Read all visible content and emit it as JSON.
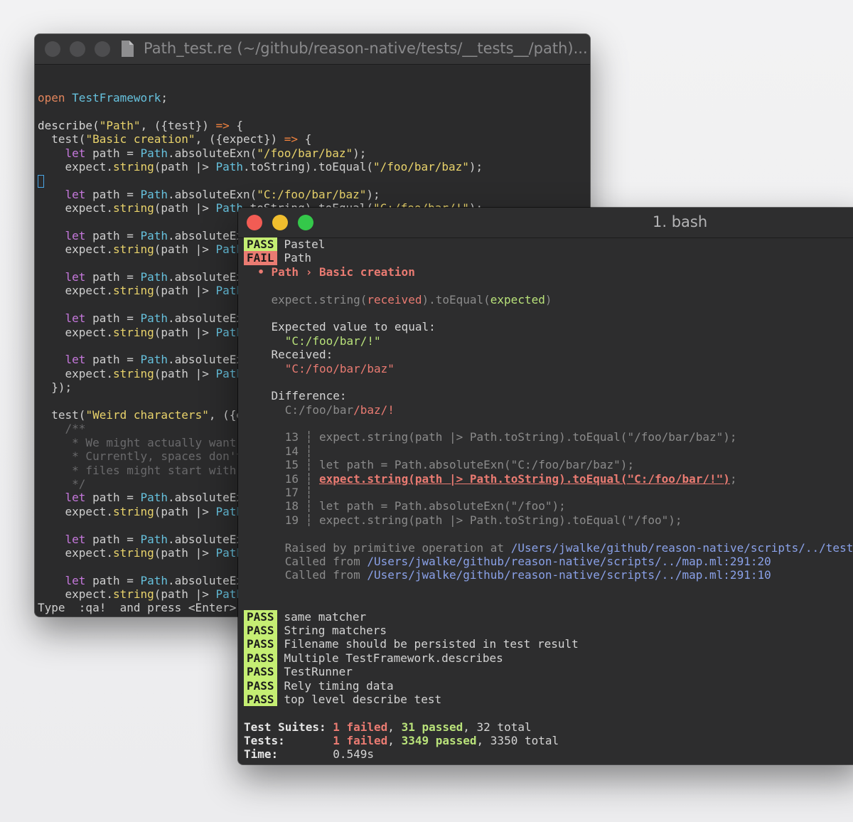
{
  "editor": {
    "title": "Path_test.re (~/github/reason-native/tests/__tests__/path)...",
    "status_line": "Type  :qa!  and press <Enter>...d",
    "code_lines": [
      [
        [
          "kw",
          "open"
        ],
        [
          "",
          " "
        ],
        [
          "mod",
          "TestFramework"
        ],
        [
          "",
          ";"
        ]
      ],
      [],
      [
        [
          "fn",
          "describe("
        ],
        [
          "str",
          "\"Path\""
        ],
        [
          "",
          ", ({test}) "
        ],
        [
          "op",
          "=>"
        ],
        [
          "",
          " {"
        ]
      ],
      [
        [
          "",
          "  test("
        ],
        [
          "str",
          "\"Basic creation\""
        ],
        [
          "",
          ", ({expect}) "
        ],
        [
          "op",
          "=>"
        ],
        [
          "",
          " {"
        ]
      ],
      [
        [
          "",
          "    "
        ],
        [
          "let",
          "let"
        ],
        [
          "",
          " path = "
        ],
        [
          "mod",
          "Path"
        ],
        [
          "",
          ".absoluteExn("
        ],
        [
          "str",
          "\"/foo/bar/baz\""
        ],
        [
          "",
          ");"
        ]
      ],
      [
        [
          "",
          "    expect."
        ],
        [
          "str",
          "string"
        ],
        [
          "",
          "(path |> "
        ],
        [
          "mod",
          "Path"
        ],
        [
          "",
          ".toString).toEqual("
        ],
        [
          "str",
          "\"/foo/bar/baz\""
        ],
        [
          "",
          ");"
        ]
      ],
      [
        [
          "cursor",
          ""
        ]
      ],
      [
        [
          "",
          "    "
        ],
        [
          "let",
          "let"
        ],
        [
          "",
          " path = "
        ],
        [
          "mod",
          "Path"
        ],
        [
          "",
          ".absoluteExn("
        ],
        [
          "str",
          "\"C:/foo/bar/baz\""
        ],
        [
          "",
          ");"
        ]
      ],
      [
        [
          "",
          "    expect."
        ],
        [
          "str",
          "string"
        ],
        [
          "",
          "(path |> "
        ],
        [
          "mod",
          "Path"
        ],
        [
          "",
          ".toString).toEqual("
        ],
        [
          "str",
          "\"C:/foo/bar/!\""
        ],
        [
          "",
          ");"
        ]
      ],
      [],
      [
        [
          "",
          "    "
        ],
        [
          "let",
          "let"
        ],
        [
          "",
          " path = "
        ],
        [
          "mod",
          "Path"
        ],
        [
          "",
          ".absoluteExn("
        ]
      ],
      [
        [
          "",
          "    expect."
        ],
        [
          "str",
          "string"
        ],
        [
          "",
          "(path |> "
        ],
        [
          "mod",
          "Path"
        ],
        [
          "",
          ".t"
        ]
      ],
      [],
      [
        [
          "",
          "    "
        ],
        [
          "let",
          "let"
        ],
        [
          "",
          " path = "
        ],
        [
          "mod",
          "Path"
        ],
        [
          "",
          ".absoluteExn("
        ]
      ],
      [
        [
          "",
          "    expect."
        ],
        [
          "str",
          "string"
        ],
        [
          "",
          "(path |> "
        ],
        [
          "mod",
          "Path"
        ],
        [
          "",
          ".t"
        ]
      ],
      [],
      [
        [
          "",
          "    "
        ],
        [
          "let",
          "let"
        ],
        [
          "",
          " path = "
        ],
        [
          "mod",
          "Path"
        ],
        [
          "",
          ".absoluteExn("
        ]
      ],
      [
        [
          "",
          "    expect."
        ],
        [
          "str",
          "string"
        ],
        [
          "",
          "(path |> "
        ],
        [
          "mod",
          "Path"
        ],
        [
          "",
          ".t"
        ]
      ],
      [],
      [
        [
          "",
          "    "
        ],
        [
          "let",
          "let"
        ],
        [
          "",
          " path = "
        ],
        [
          "mod",
          "Path"
        ],
        [
          "",
          ".absoluteExn("
        ]
      ],
      [
        [
          "",
          "    expect."
        ],
        [
          "str",
          "string"
        ],
        [
          "",
          "(path |> "
        ],
        [
          "mod",
          "Path"
        ],
        [
          "",
          ".t"
        ]
      ],
      [
        [
          "",
          "  });"
        ]
      ],
      [],
      [
        [
          "",
          "  test("
        ],
        [
          "str",
          "\"Weird characters\""
        ],
        [
          "",
          ", ({exp"
        ]
      ],
      [
        [
          "cm",
          "    /**"
        ]
      ],
      [
        [
          "cm",
          "     * We might actually want to"
        ]
      ],
      [
        [
          "cm",
          "     * Currently, spaces don't n"
        ]
      ],
      [
        [
          "cm",
          "     * files might start with a"
        ]
      ],
      [
        [
          "cm",
          "     */"
        ]
      ],
      [
        [
          "",
          "    "
        ],
        [
          "let",
          "let"
        ],
        [
          "",
          " path = "
        ],
        [
          "mod",
          "Path"
        ],
        [
          "",
          ".absoluteExn("
        ]
      ],
      [
        [
          "",
          "    expect."
        ],
        [
          "str",
          "string"
        ],
        [
          "",
          "(path |> "
        ],
        [
          "mod",
          "Path"
        ],
        [
          "",
          ".t"
        ]
      ],
      [],
      [
        [
          "",
          "    "
        ],
        [
          "let",
          "let"
        ],
        [
          "",
          " path = "
        ],
        [
          "mod",
          "Path"
        ],
        [
          "",
          ".absoluteExn("
        ]
      ],
      [
        [
          "",
          "    expect."
        ],
        [
          "str",
          "string"
        ],
        [
          "",
          "(path |> "
        ],
        [
          "mod",
          "Path"
        ],
        [
          "",
          ".t"
        ]
      ],
      [],
      [
        [
          "",
          "    "
        ],
        [
          "let",
          "let"
        ],
        [
          "",
          " path = "
        ],
        [
          "mod",
          "Path"
        ],
        [
          "",
          ".absoluteExn("
        ]
      ],
      [
        [
          "",
          "    expect."
        ],
        [
          "str",
          "string"
        ],
        [
          "",
          "(path |> "
        ],
        [
          "mod",
          "Path"
        ],
        [
          "",
          ".t"
        ]
      ]
    ]
  },
  "terminal": {
    "title": "1. bash",
    "lines": [
      [
        [
          "badge-pass",
          "PASS"
        ],
        [
          "",
          "Pastel"
        ]
      ],
      [
        [
          "badge-fail",
          "FAIL"
        ],
        [
          "",
          "Path"
        ]
      ],
      [
        [
          "red bold",
          "  • Path › Basic creation"
        ]
      ],
      [],
      [
        [
          "dim",
          "    expect.string("
        ],
        [
          "red",
          "received"
        ],
        [
          "dim",
          ").toEqual("
        ],
        [
          "green",
          "expected"
        ],
        [
          "dim",
          ")"
        ]
      ],
      [],
      [
        [
          "",
          "    Expected value to equal:"
        ]
      ],
      [
        [
          "green",
          "      \"C:/foo/bar/!\""
        ]
      ],
      [
        [
          "",
          "    Received:"
        ]
      ],
      [
        [
          "red",
          "      \"C:/foo/bar/baz\""
        ]
      ],
      [],
      [
        [
          "",
          "    Difference:"
        ]
      ],
      [
        [
          "dim",
          "      C:/foo/bar"
        ],
        [
          "red",
          "/baz/!"
        ]
      ],
      [],
      [
        [
          "dim",
          "      13 ┆ expect.string(path |> Path.toString).toEqual(\"/foo/bar/baz\");"
        ]
      ],
      [
        [
          "dim",
          "      14 ┆"
        ]
      ],
      [
        [
          "dim",
          "      15 ┆ let path = Path.absoluteExn(\"C:/foo/bar/baz\");"
        ]
      ],
      [
        [
          "dim",
          "      16 ┆ "
        ],
        [
          "red bold ul",
          "expect.string(path |> Path.toString).toEqual(\"C:/foo/bar/!\")"
        ],
        [
          "dim",
          ";"
        ]
      ],
      [
        [
          "dim",
          "      17 ┆"
        ]
      ],
      [
        [
          "dim",
          "      18 ┆ let path = Path.absoluteExn(\"/foo\");"
        ]
      ],
      [
        [
          "dim",
          "      19 ┆ expect.string(path |> Path.toString).toEqual(\"/foo\");"
        ]
      ],
      [],
      [
        [
          "dim",
          "      Raised by primitive operation at "
        ],
        [
          "path",
          "/Users/jwalke/github/reason-native/scripts/../tests/__test"
        ]
      ],
      [
        [
          "dim",
          "      Called from "
        ],
        [
          "path",
          "/Users/jwalke/github/reason-native/scripts/../map.ml:291:20"
        ]
      ],
      [
        [
          "dim",
          "      Called from "
        ],
        [
          "path",
          "/Users/jwalke/github/reason-native/scripts/../map.ml:291:10"
        ]
      ],
      [],
      [],
      [
        [
          "badge-pass",
          "PASS"
        ],
        [
          "",
          "same matcher"
        ]
      ],
      [
        [
          "badge-pass",
          "PASS"
        ],
        [
          "",
          "String matchers"
        ]
      ],
      [
        [
          "badge-pass",
          "PASS"
        ],
        [
          "",
          "Filename should be persisted in test result"
        ]
      ],
      [
        [
          "badge-pass",
          "PASS"
        ],
        [
          "",
          "Multiple TestFramework.describes"
        ]
      ],
      [
        [
          "badge-pass",
          "PASS"
        ],
        [
          "",
          "TestRunner"
        ]
      ],
      [
        [
          "badge-pass",
          "PASS"
        ],
        [
          "",
          "Rely timing data"
        ]
      ],
      [
        [
          "badge-pass",
          "PASS"
        ],
        [
          "",
          "top level describe test"
        ]
      ],
      [],
      [
        [
          "ts-label",
          "Test Suites: "
        ],
        [
          "red bold",
          "1 failed"
        ],
        [
          "",
          ", "
        ],
        [
          "green bold",
          "31 passed"
        ],
        [
          "",
          ", 32 total"
        ]
      ],
      [
        [
          "ts-label",
          "Tests:       "
        ],
        [
          "red bold",
          "1 failed"
        ],
        [
          "",
          ", "
        ],
        [
          "green bold",
          "3349 passed"
        ],
        [
          "",
          ", 3350 total"
        ]
      ],
      [
        [
          "ts-label",
          "Time:        "
        ],
        [
          "",
          "0.549s"
        ]
      ]
    ]
  }
}
